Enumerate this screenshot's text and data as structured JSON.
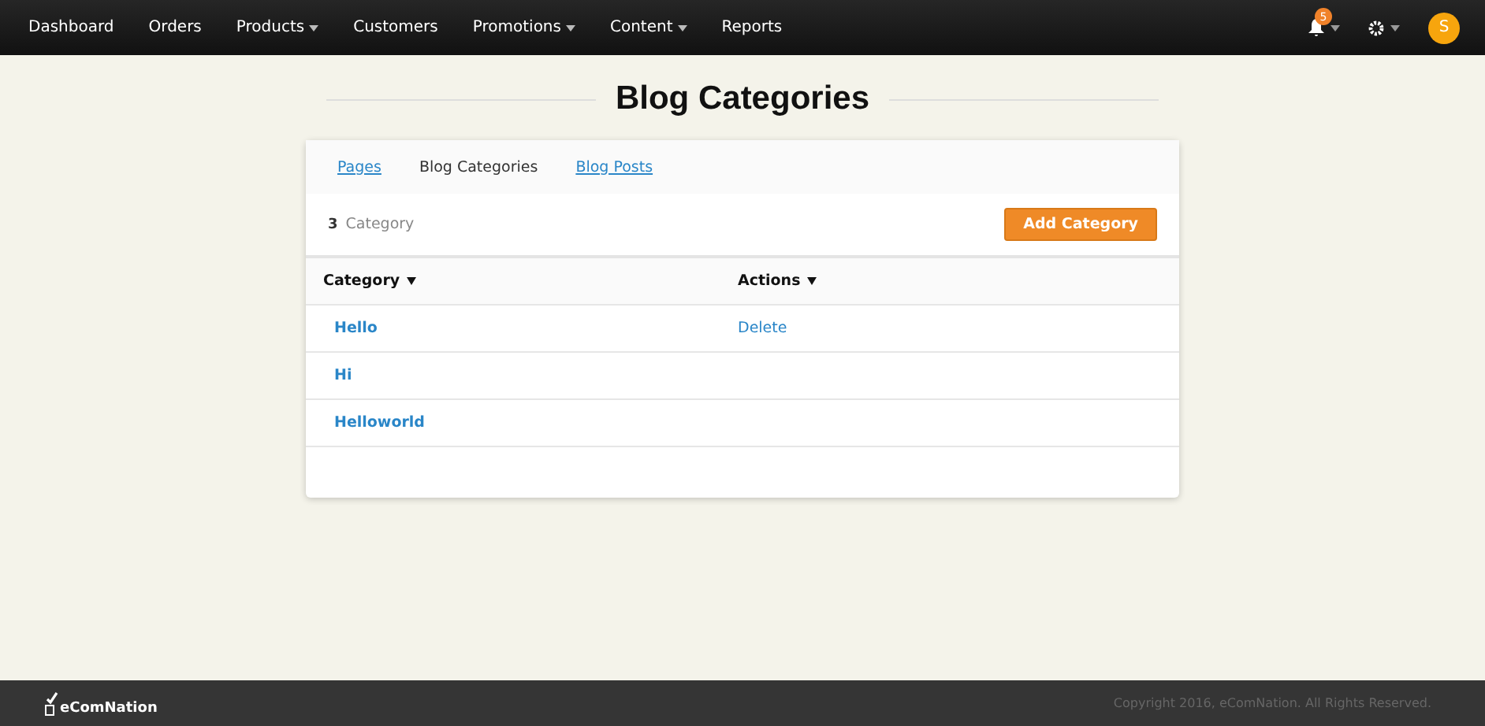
{
  "nav": {
    "items": [
      {
        "label": "Dashboard",
        "dropdown": false
      },
      {
        "label": "Orders",
        "dropdown": false
      },
      {
        "label": "Products",
        "dropdown": true
      },
      {
        "label": "Customers",
        "dropdown": false
      },
      {
        "label": "Promotions",
        "dropdown": true
      },
      {
        "label": "Content",
        "dropdown": true
      },
      {
        "label": "Reports",
        "dropdown": false
      }
    ],
    "notification_count": "5",
    "avatar": "S"
  },
  "page_title": "Blog Categories",
  "tabs": [
    {
      "label": "Pages",
      "selected": false
    },
    {
      "label": "Blog Categories",
      "selected": true
    },
    {
      "label": "Blog Posts",
      "selected": false
    }
  ],
  "summary": {
    "count": "3",
    "label": "Category"
  },
  "add_button": "Add Category",
  "table": {
    "columns": [
      "Category",
      "Actions"
    ],
    "rows": [
      {
        "name": "Hello",
        "action": "Delete"
      },
      {
        "name": "Hi"
      },
      {
        "name": "Helloworld"
      }
    ]
  },
  "footer": {
    "logo": "eComNation",
    "copyright": "Copyright 2016, eComNation. All Rights Reserved."
  }
}
